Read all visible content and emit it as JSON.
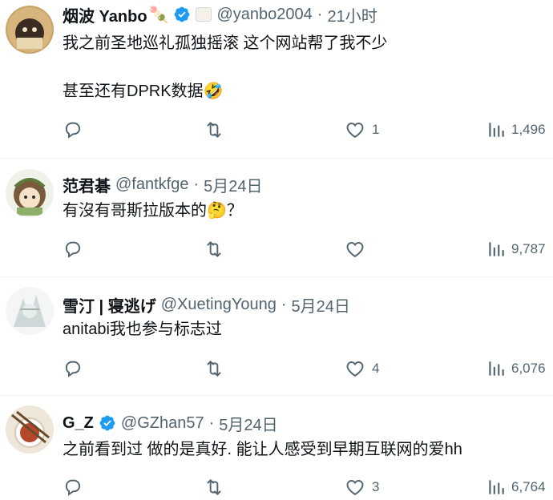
{
  "tweets": [
    {
      "name": "烟波 Yanbo",
      "name_emoji": "🍡",
      "verified": true,
      "has_label_icon": true,
      "handle": "@yanbo2004",
      "separator": "·",
      "time": "21小时",
      "lines": [
        "我之前圣地巡礼孤独摇滚 这个网站帮了我不少",
        "甚至还有DPRK数据🤣"
      ],
      "replies": "",
      "retweets": "",
      "likes": "1",
      "views": "1,496"
    },
    {
      "name": "范君碁",
      "verified": false,
      "handle": "@fantkfge",
      "separator": "·",
      "time": "5月24日",
      "lines": [
        "有沒有哥斯拉版本的🤔？"
      ],
      "replies": "",
      "retweets": "",
      "likes": "",
      "views": "9,787"
    },
    {
      "name": "雪汀 | 寝逃げ",
      "verified": false,
      "handle": "@XuetingYoung",
      "separator": "·",
      "time": "5月24日",
      "lines": [
        "anitabi我也参与标志过"
      ],
      "replies": "",
      "retweets": "",
      "likes": "4",
      "views": "6,076"
    },
    {
      "name": "G_Z",
      "verified": true,
      "handle": "@GZhan57",
      "separator": "·",
      "time": "5月24日",
      "lines": [
        "之前看到过 做的是真好. 能让人感受到早期互联网的爱hh"
      ],
      "replies": "",
      "retweets": "",
      "likes": "3",
      "views": "6,764"
    }
  ],
  "colors": {
    "text": "#0f1419",
    "secondary": "#536471",
    "verified": "#1d9bf0",
    "divider": "#eff3f4"
  },
  "icons": {
    "reply": "reply-icon",
    "retweet": "retweet-icon",
    "like": "heart-icon",
    "views": "views-bar-chart-icon",
    "verified": "verified-badge-icon"
  }
}
